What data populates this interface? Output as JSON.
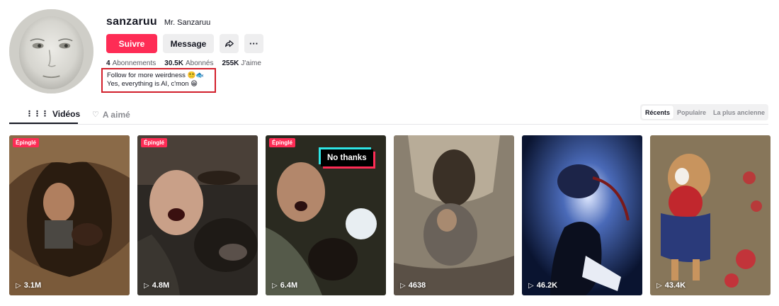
{
  "profile": {
    "username": "sanzaruu",
    "nickname": "Mr. Sanzaruu",
    "follow_label": "Suivre",
    "message_label": "Message",
    "share_icon": "share-arrow-icon",
    "more_icon": "more-dots-icon",
    "more_label": "···",
    "stats": [
      {
        "value": "4",
        "label": "Abonnements"
      },
      {
        "value": "30.5K",
        "label": "Abonnés"
      },
      {
        "value": "255K",
        "label": "J'aime"
      }
    ],
    "bio_line1": "Follow for more weirdness 😵‍💫🐟",
    "bio_line2": "Yes, everything is AI, c'mon 😁"
  },
  "tabs": [
    {
      "label": "Vidéos",
      "icon": "grid-icon"
    },
    {
      "label": "A aimé",
      "icon": "heart-lock-icon"
    }
  ],
  "sort": {
    "options": [
      "Récents",
      "Populaire",
      "La plus ancienne"
    ],
    "selected": "Récents"
  },
  "videos": [
    {
      "views": "3.1M",
      "pinned": true,
      "pin_label": "Épinglé"
    },
    {
      "views": "4.8M",
      "pinned": true,
      "pin_label": "Épinglé"
    },
    {
      "views": "6.4M",
      "pinned": true,
      "pin_label": "Épinglé",
      "overlay_text": "No thanks"
    },
    {
      "views": "4638",
      "pinned": false
    },
    {
      "views": "46.2K",
      "pinned": false
    },
    {
      "views": "43.4K",
      "pinned": false
    }
  ],
  "colors": {
    "accent": "#fe2c55",
    "highlight_box": "#d21f2b",
    "text": "#161823",
    "muted": "#8a8b91"
  }
}
